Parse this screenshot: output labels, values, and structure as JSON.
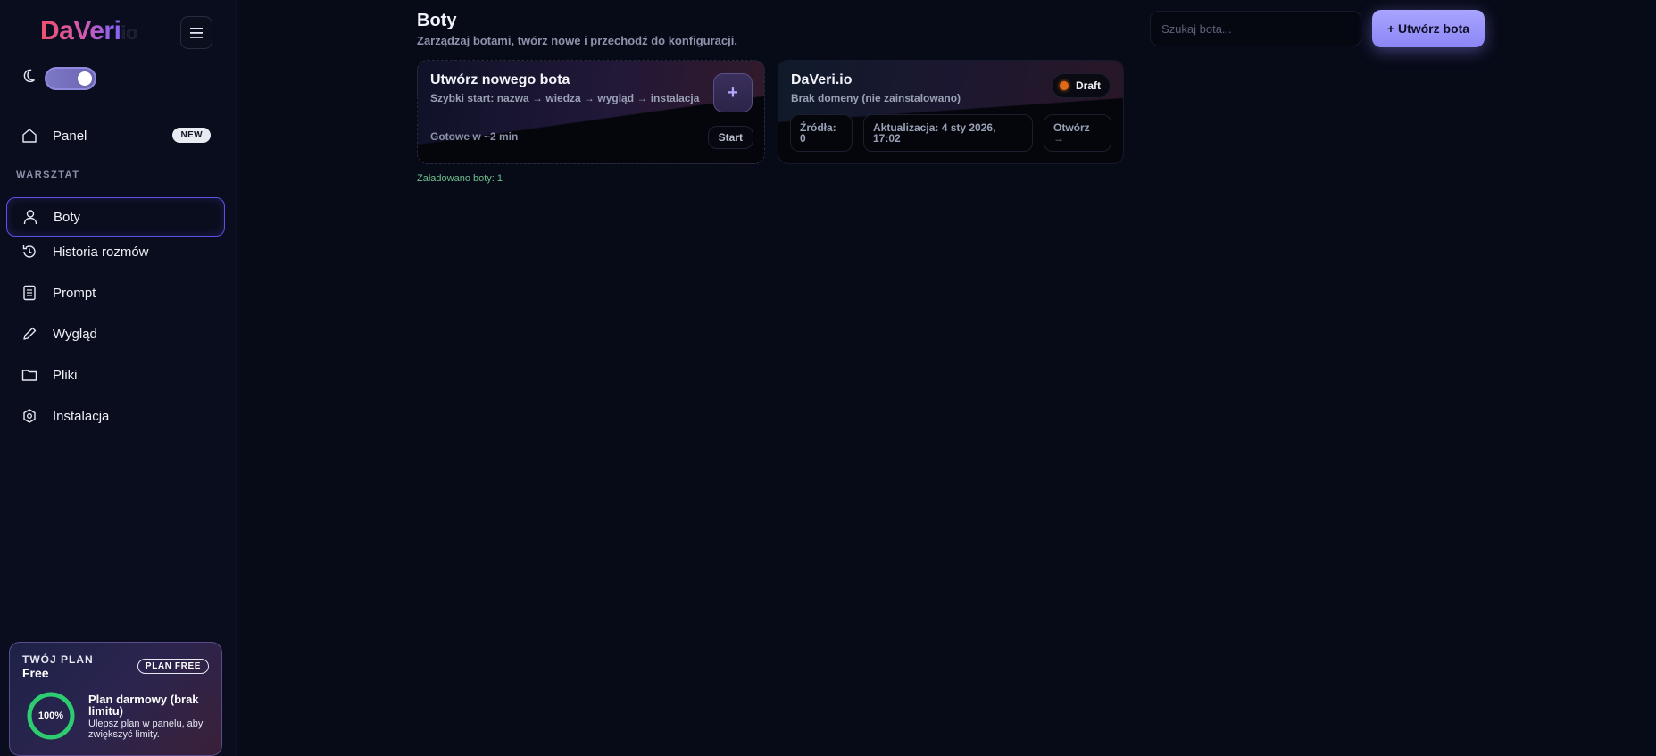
{
  "brand": {
    "logo_main": "DaVeri",
    "logo_suffix": "io"
  },
  "sidebar": {
    "section_label": "WARSZTAT",
    "items": [
      {
        "label": "Panel",
        "badge": "NEW",
        "icon": "home-icon"
      },
      {
        "label": "Boty",
        "icon": "user-icon",
        "active": true
      },
      {
        "label": "Historia rozmów",
        "icon": "history-icon"
      },
      {
        "label": "Prompt",
        "icon": "document-icon"
      },
      {
        "label": "Wygląd",
        "icon": "pencil-icon"
      },
      {
        "label": "Pliki",
        "icon": "folder-icon"
      },
      {
        "label": "Instalacja",
        "icon": "install-icon"
      }
    ],
    "plan": {
      "title": "TWÓJ PLAN",
      "name": "Free",
      "badge": "PLAN FREE",
      "percent_label": "100%",
      "usage": 1.0,
      "heading": "Plan darmowy (brak limitu)",
      "description": "Ulepsz plan w panelu, aby zwiększyć limity."
    }
  },
  "header": {
    "title": "Boty",
    "subtitle": "Zarządzaj botami, twórz nowe i przechodź do konfiguracji.",
    "search_placeholder": "Szukaj bota...",
    "create_label": "+ Utwórz bota"
  },
  "new_bot_card": {
    "title": "Utwórz nowego bota",
    "subtitle": "Szybki start: nazwa → wiedza → wygląd → instalacja",
    "plus": "+",
    "ready": "Gotowe w ~2 min",
    "start_label": "Start"
  },
  "bots": [
    {
      "name": "DaVeri.io",
      "domain": "Brak domeny (nie zainstalowano)",
      "status": "Draft",
      "status_color": "#e06a14",
      "sources_label": "Źródła:",
      "sources_value": "0",
      "updated_label": "Aktualizacja: 4 sty 2026,",
      "updated_time": "17:02",
      "open_label": "Otwórz",
      "open_arrow": "→"
    }
  ],
  "footer": {
    "loaded": "Załadowano boty: 1"
  },
  "colors": {
    "accent": "#8c86f5",
    "active_border": "#5b52e8",
    "success": "#2ecc71"
  }
}
